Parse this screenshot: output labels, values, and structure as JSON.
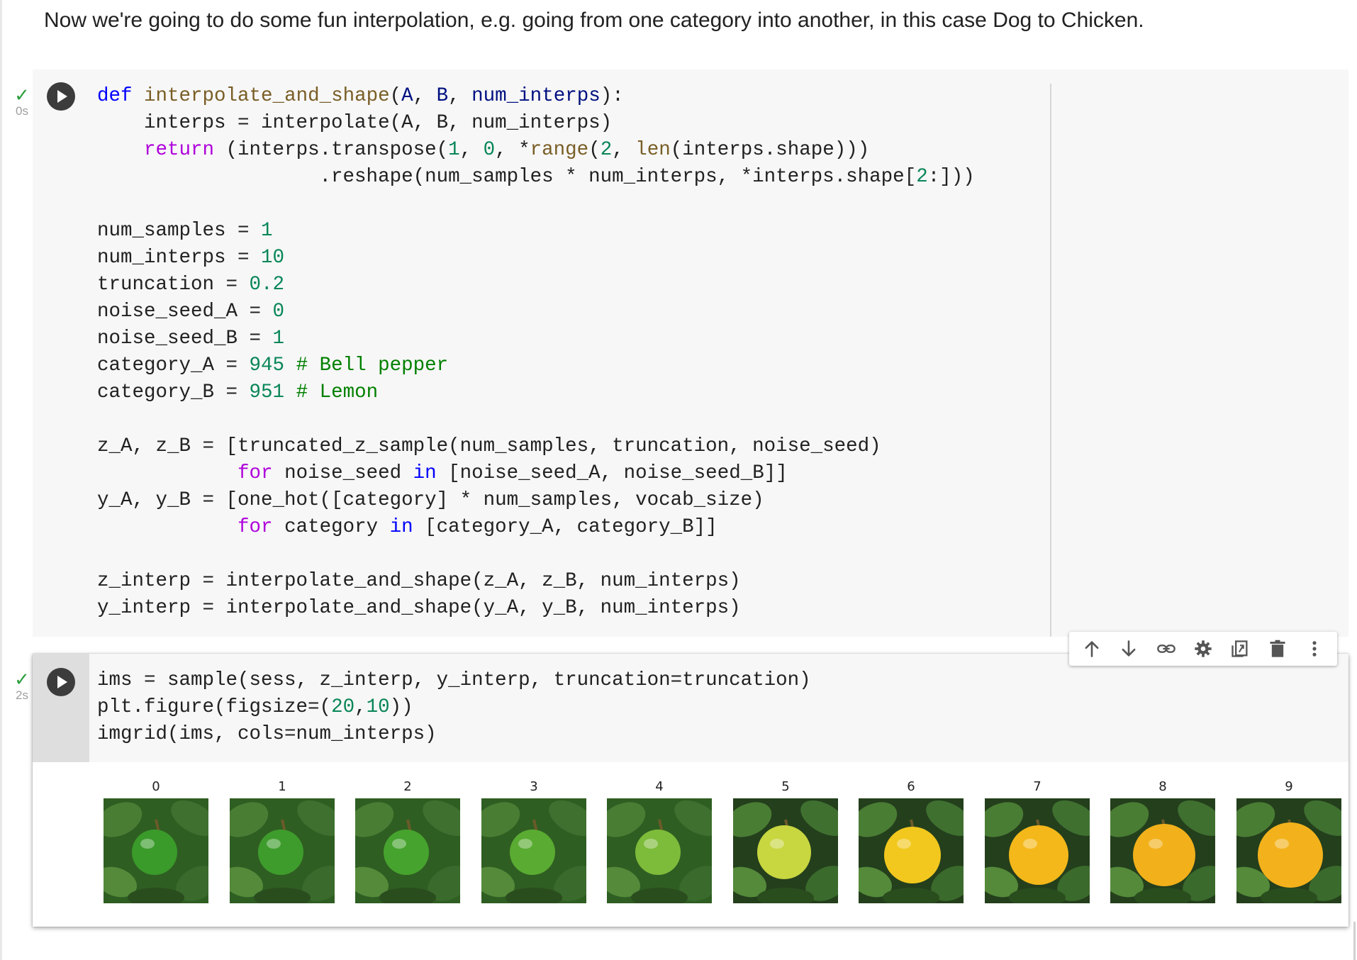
{
  "intro_text": "Now we're going to do some fun interpolation, e.g. going from one category into another, in this case Dog to Chicken.",
  "cells": [
    {
      "status_icon": "check",
      "exec_time": "0s"
    },
    {
      "status_icon": "check",
      "exec_time": "2s"
    }
  ],
  "cell_toolbar": [
    {
      "name": "move-up",
      "icon": "arrow-up-icon"
    },
    {
      "name": "move-down",
      "icon": "arrow-down-icon"
    },
    {
      "name": "link",
      "icon": "link-icon"
    },
    {
      "name": "settings",
      "icon": "gear-icon"
    },
    {
      "name": "mirror",
      "icon": "mirror-cell-icon"
    },
    {
      "name": "delete",
      "icon": "trash-icon"
    },
    {
      "name": "more",
      "icon": "more-vert-icon"
    }
  ],
  "code_cell_1_lines": [
    "def interpolate_and_shape(A, B, num_interps):",
    "    interps = interpolate(A, B, num_interps)",
    "    return (interps.transpose(1, 0, *range(2, len(interps.shape)))",
    "                   .reshape(num_samples * num_interps, *interps.shape[2:]))",
    "",
    "num_samples = 1",
    "num_interps = 10",
    "truncation = 0.2",
    "noise_seed_A = 0",
    "noise_seed_B = 1",
    "category_A = 945 # Bell pepper",
    "category_B = 951 # Lemon",
    "",
    "z_A, z_B = [truncated_z_sample(num_samples, truncation, noise_seed)",
    "            for noise_seed in [noise_seed_A, noise_seed_B]]",
    "y_A, y_B = [one_hot([category] * num_samples, vocab_size)",
    "            for category in [category_A, category_B]]",
    "",
    "z_interp = interpolate_and_shape(z_A, z_B, num_interps)",
    "y_interp = interpolate_and_shape(y_A, y_B, num_interps)"
  ],
  "code_cell_2_lines": [
    "ims = sample(sess, z_interp, y_interp, truncation=truncation)",
    "plt.figure(figsize=(20,10))",
    "imgrid(ims, cols=num_interps)"
  ],
  "output_images": {
    "labels": [
      "0",
      "1",
      "2",
      "3",
      "4",
      "5",
      "6",
      "7",
      "8",
      "9"
    ],
    "fruit_colors": [
      "#3a9a2a",
      "#3e9c2c",
      "#46a32e",
      "#5aab32",
      "#7dbb3a",
      "#c8d640",
      "#f2c81e",
      "#f4b81a",
      "#f2b01a",
      "#f3b21c"
    ]
  },
  "colors": {
    "keyword": "#0000ff",
    "control": "#af00db",
    "function": "#795e26",
    "param": "#001080",
    "number": "#098658",
    "comment": "#008000",
    "success": "#2e9e3e"
  }
}
